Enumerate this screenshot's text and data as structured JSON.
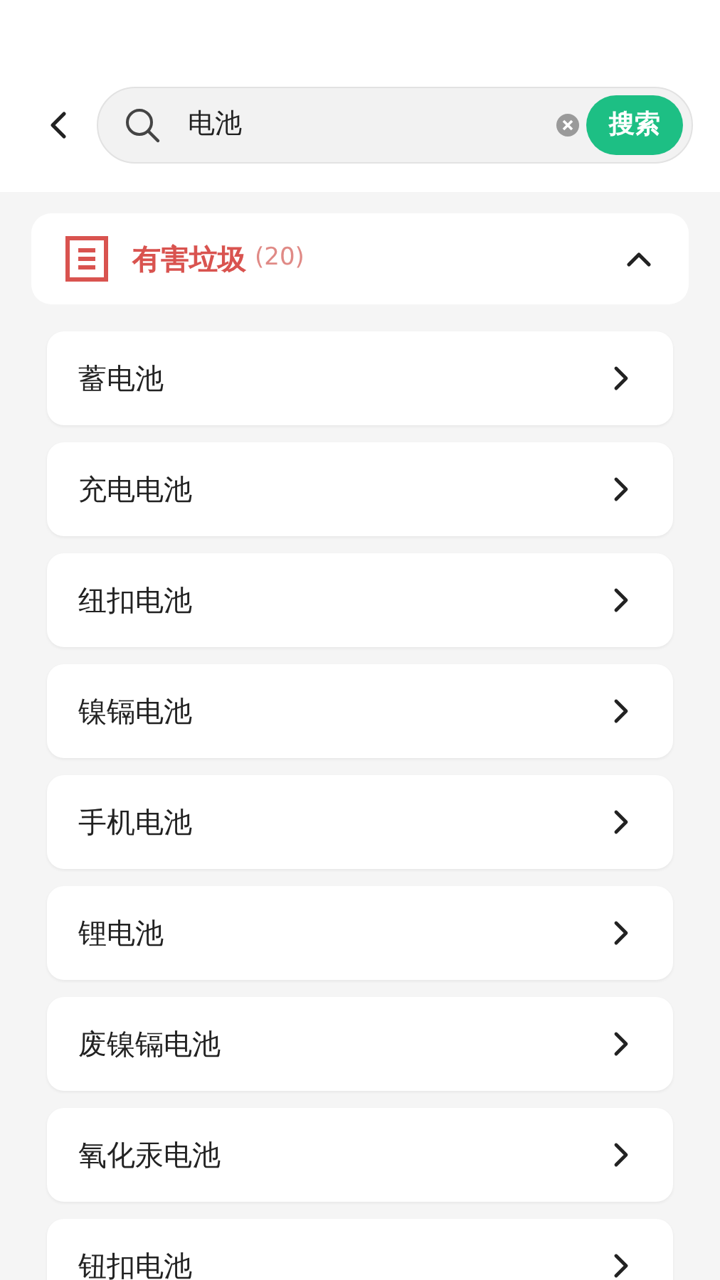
{
  "search": {
    "value": "电池",
    "button": "搜索"
  },
  "category": {
    "title": "有害垃圾",
    "count": "(20)",
    "expanded": true
  },
  "items": [
    {
      "label": "蓄电池"
    },
    {
      "label": "充电电池"
    },
    {
      "label": "纽扣电池"
    },
    {
      "label": "镍镉电池"
    },
    {
      "label": "手机电池"
    },
    {
      "label": "锂电池"
    },
    {
      "label": "废镍镉电池"
    },
    {
      "label": "氧化汞电池"
    },
    {
      "label": "钮扣电池"
    }
  ]
}
